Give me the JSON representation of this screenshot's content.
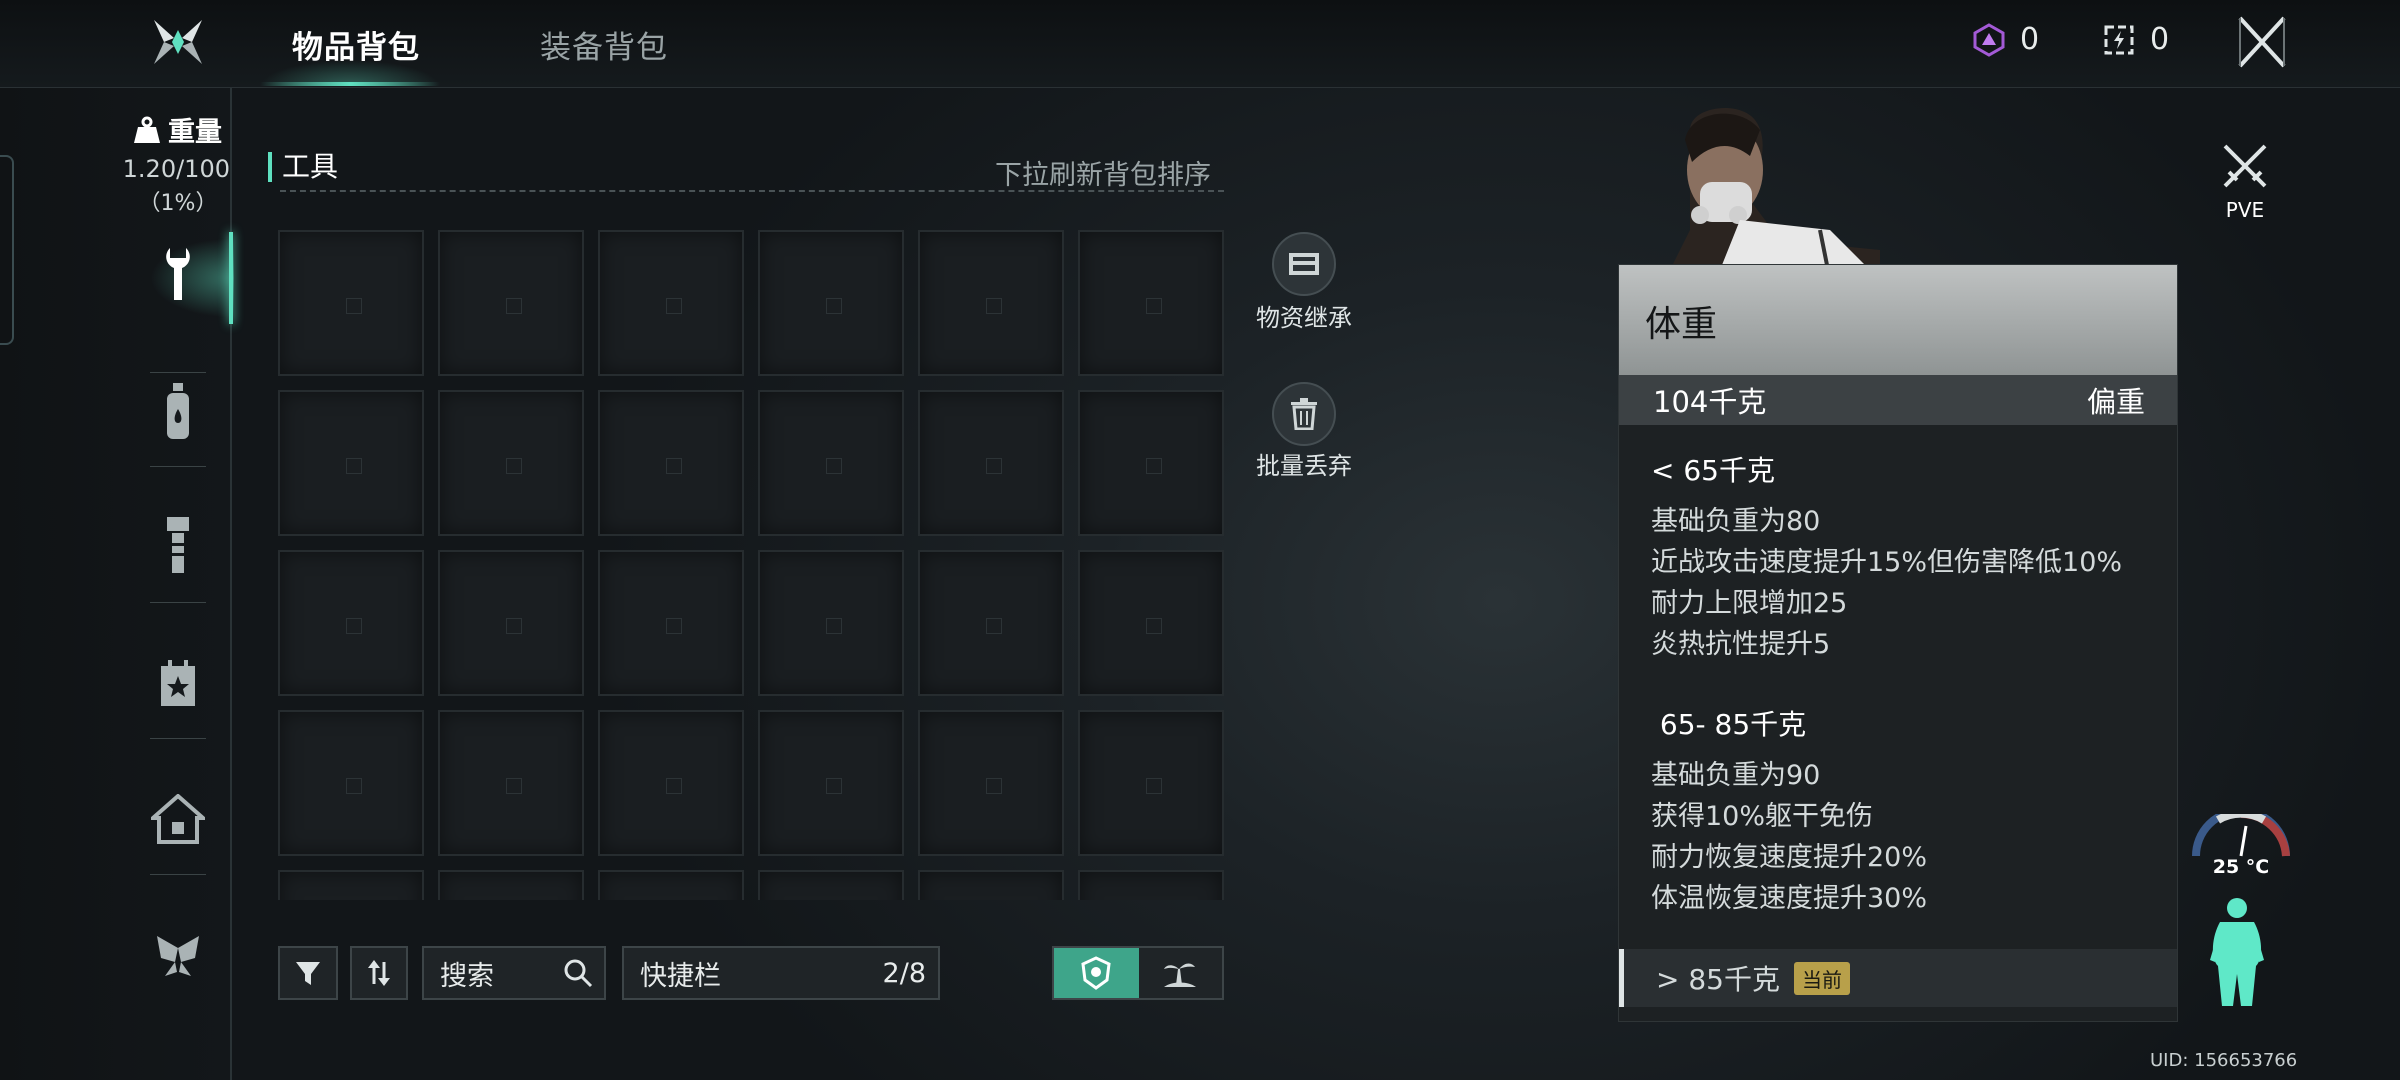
{
  "header": {
    "tabs": [
      {
        "label": "物品背包",
        "active": true
      },
      {
        "label": "装备背包",
        "active": false
      }
    ],
    "currencies": [
      {
        "icon": "purple-gem-icon",
        "value": "0"
      },
      {
        "icon": "token-box-icon",
        "value": "0"
      }
    ],
    "close_icon": "close-x-icon"
  },
  "sidebar": {
    "weight_label": "重量",
    "weight_value": "1.20/100",
    "weight_percent": "（1%）",
    "categories": [
      {
        "icon": "wrench-icon",
        "active": true
      },
      {
        "icon": "bottle-icon",
        "active": false
      },
      {
        "icon": "flashlight-icon",
        "active": false
      },
      {
        "icon": "calendar-star-icon",
        "active": false
      },
      {
        "icon": "house-icon",
        "active": false
      },
      {
        "icon": "butterfly-icon",
        "active": false
      }
    ]
  },
  "inventory": {
    "section_title": "工具",
    "sort_hint": "下拉刷新背包排序",
    "columns": 6,
    "visible_rows": 5
  },
  "side_actions": [
    {
      "icon": "crate-icon",
      "label": "物资继承"
    },
    {
      "icon": "trash-icon",
      "label": "批量丢弃"
    }
  ],
  "bottom_bar": {
    "filter_icon": "filter-icon",
    "sort_icon": "sort-icon",
    "search_label": "搜索",
    "quickbar_label": "快捷栏",
    "quickbar_count": "2/8",
    "toggle": [
      {
        "icon": "badge-icon",
        "active": true
      },
      {
        "icon": "island-icon",
        "active": false
      }
    ]
  },
  "mode": {
    "label": "PVE",
    "icon": "crossed-swords-icon"
  },
  "weight_panel": {
    "title": "体重",
    "current_weight": "104千克",
    "current_state": "偏重",
    "tiers": [
      {
        "range": "< 65千克",
        "effects": [
          "基础负重为80",
          "近战攻击速度提升15%但伤害降低10%",
          "耐力上限增加25",
          "炎热抗性提升5"
        ]
      },
      {
        "range": " 65- 85千克",
        "effects": [
          "基础负重为90",
          "获得10%躯干免伤",
          "耐力恢复速度提升20%",
          "体温恢复速度提升30%"
        ]
      }
    ],
    "footer_range": "> 85千克",
    "footer_badge": "当前"
  },
  "status": {
    "temperature": "25 °C"
  },
  "uid": "UID: 156653766",
  "colors": {
    "accent": "#5fe0c0",
    "toggle_active": "#3ea58a",
    "badge": "#b8a04a"
  }
}
